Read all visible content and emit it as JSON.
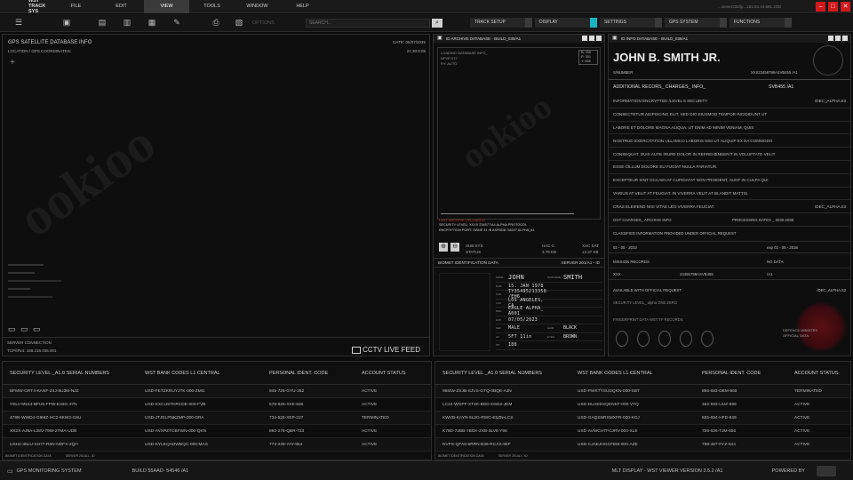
{
  "app_title": "WST TRACK SYS",
  "menu": [
    "FILE",
    "EDIT",
    "VIEW",
    "TOOLS",
    "WINDOW",
    "HELP"
  ],
  "menu_active": "VIEW",
  "address": "...server232/ip...181.54.44.681.235/",
  "toolbar": {
    "options_label": "OPTIONS",
    "search_placeholder": "SEARCH...",
    "buttons": [
      {
        "label": "TRACK SETUP",
        "on": false
      },
      {
        "label": "DISPLAY",
        "on": true
      },
      {
        "label": "SETTINGS",
        "on": false
      },
      {
        "label": "GPS SYSTEM",
        "on": false
      },
      {
        "label": "FUNCTIONS",
        "on": false
      }
    ]
  },
  "gps": {
    "title": "GPS SATELLITE DATABASE INFO",
    "date": "DATE: 05/07/2035",
    "time": "21:30:9:09",
    "location_label": "LOCATION / GPS COORDINATES:",
    "server_label": "SERVER CONNECTION",
    "server_ip": "TCP/IPv4: 168.215.035.001",
    "feed_label": "CCTV LIVE FEED"
  },
  "archive": {
    "title": "ID ARCHIVE DATABASE - BUILD_035/A1",
    "loading": "LOADING DATABASE INFO_",
    "line2": "NFVR 072",
    "line3": "RY: AUTO",
    "box": [
      "B: 205",
      "P: 301",
      "Y: 558"
    ],
    "warn": "LAST ARCHIVE UPLOADED",
    "sec1": "SECURITY LEVEL: XXXX 234577/A4 ALPHA PROTOCOL",
    "sec2": "ENCRYPTION PORT: GAME 31 /B ASFBDB /18247 ALPHA_44",
    "subsys": "SUB SYS",
    "status": "STATUS",
    "hac": "HAC-C",
    "hac_val": "3.79 KB",
    "xsc": "XSC SAT",
    "xsc_val": "13.37 KB"
  },
  "biomet": {
    "label": "BIOMET IDENTIFICATION DATA",
    "server": "SERVER 201/A1 - ID",
    "fields": [
      {
        "k": "NAME",
        "v": "JOHN",
        "k2": "SURNAME",
        "v2": "SMITH"
      },
      {
        "k": "DOB",
        "v": "15. JAN 1978"
      },
      {
        "k": "SSN",
        "v": "TY35495213358 /EH6"
      },
      {
        "k": "LOC",
        "v": "LOS ANGELES, CA"
      },
      {
        "k": "REG",
        "v": "EAGLE ALPHA_ A001"
      },
      {
        "k": "EXP",
        "v": "07/05/2023"
      },
      {
        "k": "SEX",
        "v": "MALE",
        "k2": "HAIR",
        "v2": "BLACK"
      },
      {
        "k": "HT",
        "v": "5FT 11in",
        "k2": "EYES",
        "v2": "BROWN"
      },
      {
        "k": "WT",
        "v": "188"
      }
    ]
  },
  "info": {
    "title": "ID INFO DATABASE - BUILD_036/A1",
    "name": "JOHN B. SMITH JR.",
    "snum_label": "S/NUMBER",
    "snum": "XXX23456798ASVB455 /A1",
    "add_label": "ADDITIONAL RECORS_ CHARGES_ INFO_",
    "add_val": "SVB455 /A1",
    "rows": [
      {
        "t": "INFORMATION ENCRYPTED /LEVEL 5 SECURITY",
        "r": "/DEC_ALPHA.53"
      },
      {
        "t": "CONSECTETUR ADIPISCING ELIT, SED DIO EIUSMOD TEMPOR INCIDIDUNT UT",
        "r": ""
      },
      {
        "t": "LABORE ET DOLORE MAGNA ALIQUA. UT ENIM AD MINIM VENIAM, QUIS",
        "r": ""
      },
      {
        "t": "NOSTRUD EXERCITATION ULLAMCO LABORIS NISI UT ALIQUIP EX EA COMMODO",
        "r": ""
      },
      {
        "t": "CONSEQUAT. DUIS AUTE IRURE DOLOR IN REPREHENDERIT IN VOLUPTATE VELIT",
        "r": ""
      },
      {
        "t": "ESSE CILLUM DOLORE EU FUGIAT NULLA PARIATUR.",
        "r": ""
      },
      {
        "t": "EXCEPTEUR SINT OCCAECAT CUPIDATAT NON PROIDENT, SUNT IN CULPA QUI",
        "r": ""
      },
      {
        "t": "VARIUS AT VELIT AT FEUGIAT. IN VIVERRA VELIT AT BLANDIT MATTIS.",
        "r": ""
      },
      {
        "t": "CRAS ELEIFEND NISI VITAE LEO VIVERRA FEUGIAT.",
        "r": "/DEC_ALPHA.53"
      }
    ],
    "ggt": "GGT CHARGES_ ARCHIVE INFO",
    "processing": "PROCESSING DATES _ 2030-2038",
    "classified": "CLASSIFIED INFORMATION PROVIDED UNDER OFFICIAL REQUEST",
    "date1": "02 - 05 - 2033",
    "date2": "exp 02 - 05 - 2038",
    "mission": "MISSION RECORDS",
    "nodata": "NO DATA",
    "xxx": "XXX",
    "xxxval": "23456798ASVB455",
    "xxxr": "/A1",
    "avail": "AVAILABLE WITH OFFICIAL REQUEST",
    "availr": "/DEC_ALPHA.53",
    "seclevel": "SECURITY LEVEL_ alpha ONE.ZERO",
    "fp_label": "FINGERPRINT DATA WST TF RECORDS",
    "ministry": "DEFENCE MINISTRY",
    "official": "OFFICIAL DATA"
  },
  "table_headers": [
    "SECURITY LEVEL _A1.0 SERIAL NUMBERS",
    "WST BANK CODES L1 CENTRAL",
    "PERSONAL IDENT. CODE",
    "ACCOUNT STATUS"
  ],
  "table_left": [
    [
      "BFMW-GRT4-KANF-Z4J-8U3M-NJZ",
      "USD-FETZKRUYJTK-000-ZMG",
      "945-726-GYU-262",
      "ACTIVE"
    ],
    [
      "YELV-5NS3-BFU5-FPW-E32G-37N",
      "USD-KXCUSTKRCDE-000-FVB",
      "579-825-XXE-685",
      "ACTIVE"
    ],
    [
      "479N-WWD4-G9MZ-HC2-6KW2-G6U",
      "USD-JTJELPNKZMP-000-DRA",
      "734-526-XEP-227",
      "TERMINATED"
    ],
    [
      "XX2X-AJ9A-L38V-79W-2TMA-UDB",
      "USD-AVXPZTCBFWN-000-QKN",
      "893-278-QBR-723",
      "ACTIVE"
    ],
    [
      "USH2-35LU-XH77-R5N-NDFX-2QH",
      "USD-KYLEQADWBQC-000-MAS",
      "773-439-YAY-954",
      "ACTIVE"
    ]
  ],
  "table_right": [
    [
      "96MW-ZSJB-SJVS-GTQ-4BQE-AJN",
      "USD-PWKTYSUDQKN-000-SBT",
      "886-683-DEM-668",
      "TERMINATED"
    ],
    [
      "LC24-WGPF-XT4K-BDD-DSD2-JEM",
      "USD-DLHEDXQKNKF-000-VTQ",
      "462-593-UUZ-998",
      "ACTIVE"
    ],
    [
      "KWVB-KAYR-5L2G-RWC-E5ZN-LCS",
      "USD-GAQSNRSMXFR-000-KGJ",
      "655-694-HFD-849",
      "ACTIVE"
    ],
    [
      "K78D-72BB-7BCK-2XB-3LV8-Y98",
      "USD-AVWCHTFCJRV-000-XLE",
      "726-626-TJM-656",
      "ACTIVE"
    ],
    [
      "NVPS-QFA8-6RRN-B36-RCAX-96F",
      "USD-CJAEJHGCFEM-000-AZE",
      "798-487-FYZ-544",
      "ACTIVE"
    ]
  ],
  "table_footer_left": "BIOMET IDENTIFICATION DATA",
  "table_footer_server": "SERVER 201/A1 - ID",
  "statusbar": {
    "left": "GPS MONITORING SYSTEM",
    "build": "BUILD 55AAD- 54546  /A1",
    "right": "MLT DISPLAY - WST VIEWER  VERSION 3.5.2 /A1",
    "powered": "POWERED BY"
  }
}
